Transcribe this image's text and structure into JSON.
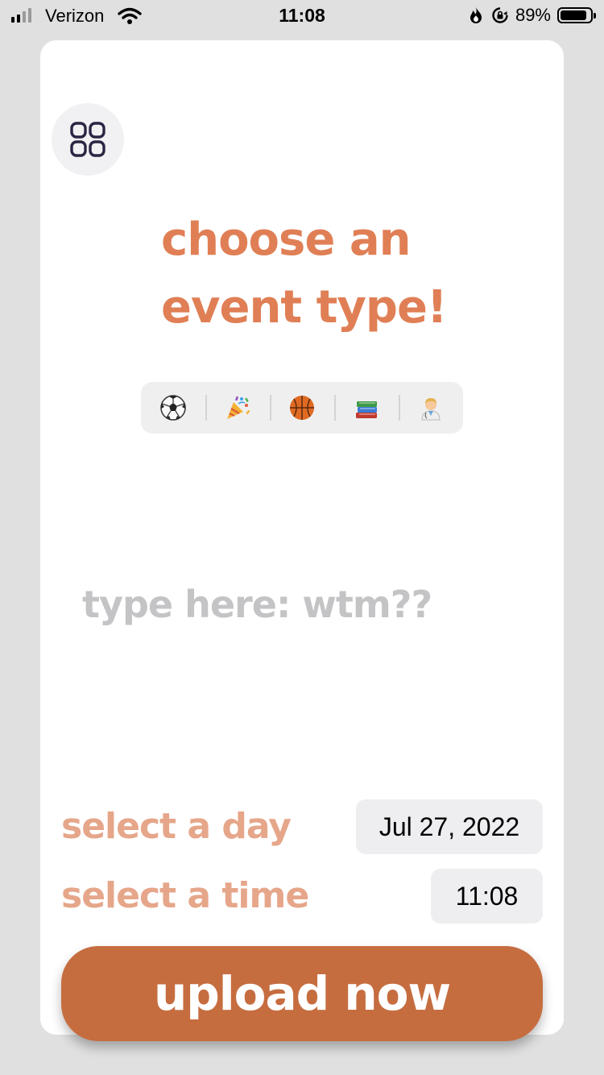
{
  "status_bar": {
    "carrier": "Verizon",
    "time": "11:08",
    "battery": "89%",
    "battery_level": 0.89,
    "icons": [
      "signal-icon",
      "wifi-icon",
      "flame-icon",
      "rotation-lock-icon",
      "battery-icon"
    ]
  },
  "menu": {
    "icon": "grid-icon"
  },
  "heading": {
    "line1": "choose an",
    "line2": "event type!"
  },
  "event_types": [
    {
      "icon": "soccer-ball-icon"
    },
    {
      "icon": "party-popper-icon"
    },
    {
      "icon": "basketball-icon"
    },
    {
      "icon": "books-icon"
    },
    {
      "icon": "doctor-icon"
    }
  ],
  "description_input": {
    "placeholder": "type here: wtm??",
    "value": ""
  },
  "day": {
    "label": "select a day",
    "value": "Jul 27, 2022"
  },
  "time": {
    "label": "select a time",
    "value": "11:08"
  },
  "upload_button": {
    "label": "upload now"
  },
  "colors": {
    "accent": "#e07f55",
    "label": "#e6a68a",
    "button": "#c66d40",
    "placeholder": "#c4c4c6"
  }
}
